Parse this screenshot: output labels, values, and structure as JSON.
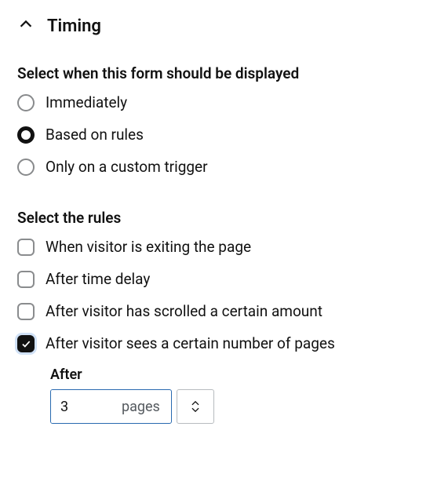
{
  "header": {
    "title": "Timing"
  },
  "displaySection": {
    "label": "Select when this form should be displayed",
    "options": [
      {
        "label": "Immediately",
        "selected": false
      },
      {
        "label": "Based on rules",
        "selected": true
      },
      {
        "label": "Only on a custom trigger",
        "selected": false
      }
    ]
  },
  "rulesSection": {
    "label": "Select the rules",
    "options": [
      {
        "label": "When visitor is exiting the page",
        "checked": false
      },
      {
        "label": "After time delay",
        "checked": false
      },
      {
        "label": "After visitor has scrolled a certain amount",
        "checked": false
      },
      {
        "label": "After visitor sees a certain number of pages",
        "checked": true
      }
    ]
  },
  "pagesRule": {
    "label": "After",
    "value": "3",
    "unit": "pages"
  }
}
